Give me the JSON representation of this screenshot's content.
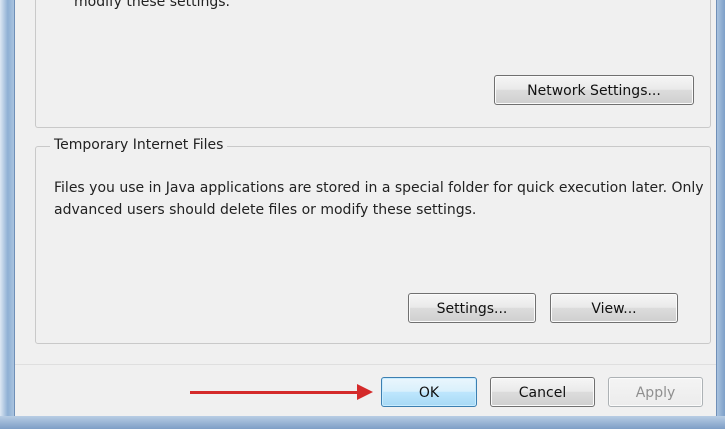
{
  "cut_text": "modify these settings.",
  "network": {
    "button_label": "Network Settings..."
  },
  "temp_files": {
    "legend": "Temporary Internet Files",
    "description": "Files you use in Java applications are stored in a special folder for quick execution later.  Only advanced users should delete files or modify these settings.",
    "settings_label": "Settings...",
    "view_label": "View..."
  },
  "footer": {
    "ok_label": "OK",
    "cancel_label": "Cancel",
    "apply_label": "Apply"
  },
  "colors": {
    "arrow": "#d42a2a",
    "default_button_border": "#3c7fb1"
  }
}
